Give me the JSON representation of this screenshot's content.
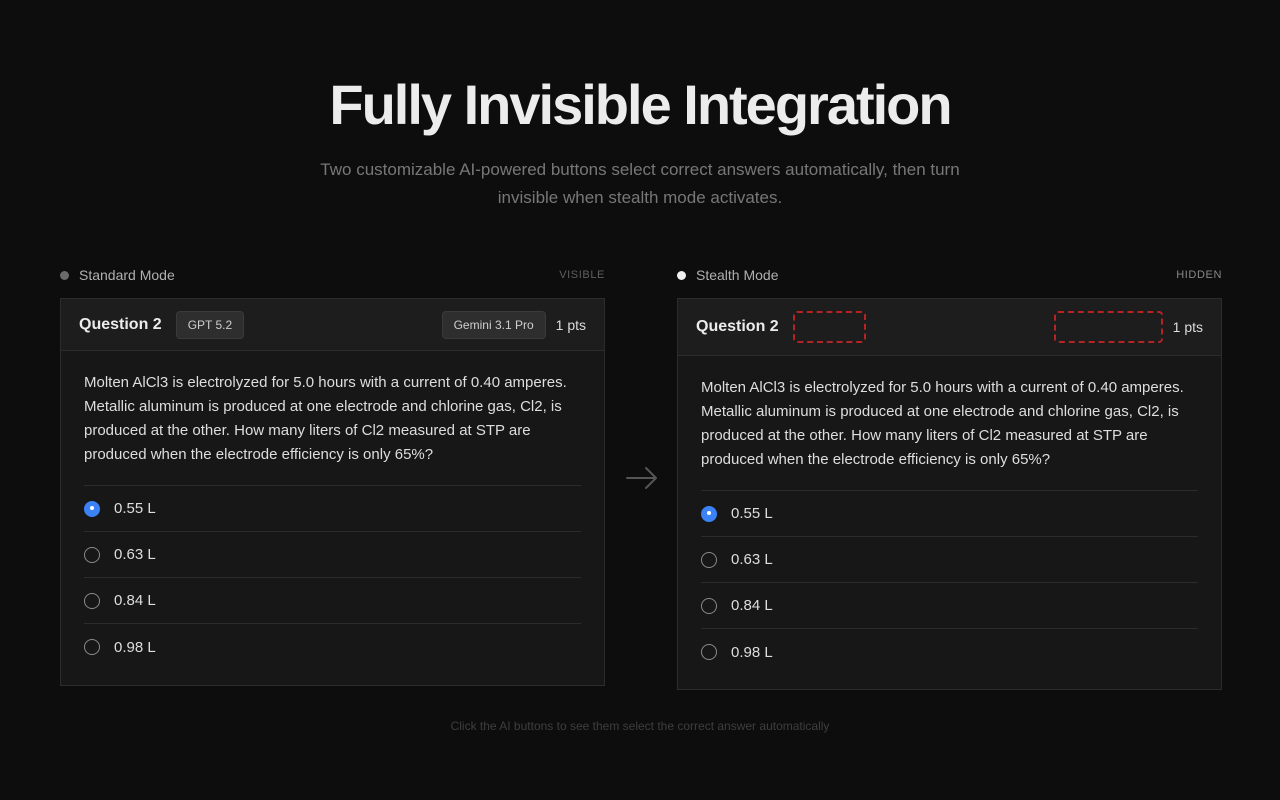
{
  "hero": {
    "title": "Fully Invisible Integration",
    "subtitle": "Two customizable AI-powered buttons select correct answers automatically, then turn invisible when stealth mode activates."
  },
  "standard": {
    "mode_label": "Standard Mode",
    "status": "VISIBLE",
    "dot_color": "#6a6a6a",
    "question_title": "Question 2",
    "ai_button_1": "GPT 5.2",
    "ai_button_2": "Gemini 3.1 Pro",
    "points": "1 pts",
    "question_text": "Molten AlCl3 is electrolyzed for 5.0 hours with a current of 0.40 amperes. Metallic aluminum is produced at one electrode and chlorine gas, Cl2, is produced at the other. How many liters of Cl2 measured at STP are produced when the electrode efficiency is only 65%?",
    "options": [
      "0.55 L",
      "0.63 L",
      "0.84 L",
      "0.98 L"
    ],
    "selected_index": 0
  },
  "stealth": {
    "mode_label": "Stealth Mode",
    "status": "HIDDEN",
    "dot_color": "#f0f0f0",
    "question_title": "Question 2",
    "points": "1 pts",
    "question_text": "Molten AlCl3 is electrolyzed for 5.0 hours with a current of 0.40 amperes. Metallic aluminum is produced at one electrode and chlorine gas, Cl2, is produced at the other. How many liters of Cl2 measured at STP are produced when the electrode efficiency is only 65%?",
    "options": [
      "0.55 L",
      "0.63 L",
      "0.84 L",
      "0.98 L"
    ],
    "selected_index": 0
  },
  "footer": {
    "hint": "Click the AI buttons to see them select the correct answer automatically"
  },
  "colors": {
    "accent": "#3b82f6",
    "ghost_border": "#b42424",
    "background": "#0d0d0d"
  },
  "icons": {
    "arrow": "arrow-right-icon"
  }
}
